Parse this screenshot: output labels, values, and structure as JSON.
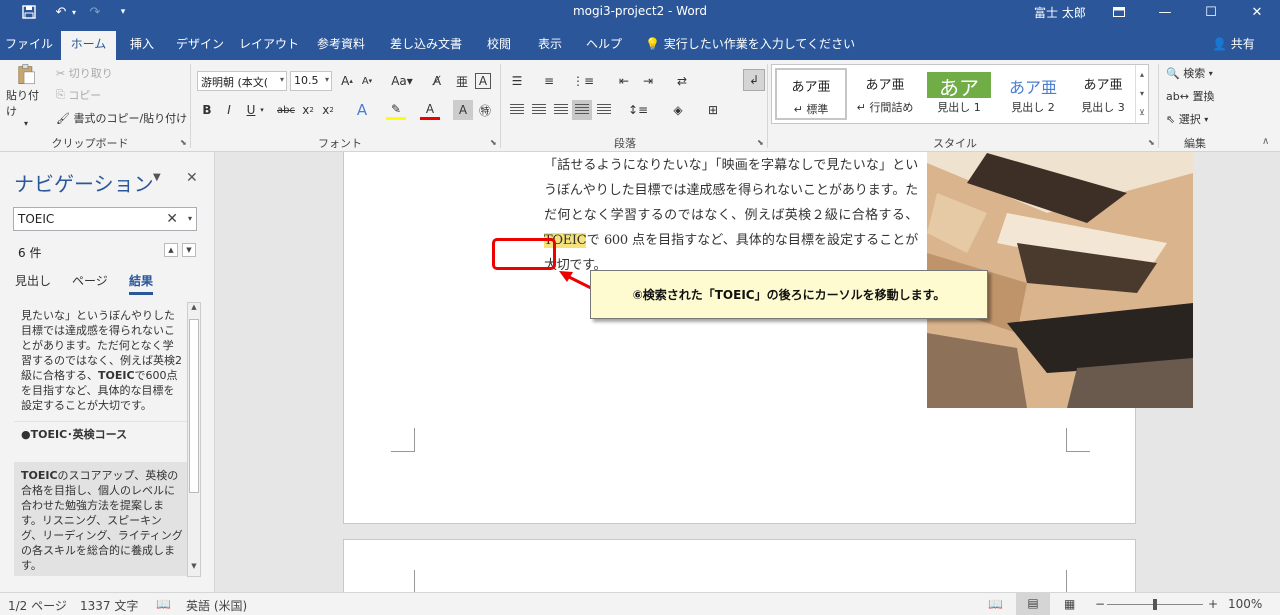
{
  "app": {
    "doc_title": "mogi3-project2  -  Word",
    "user": "富士 太郎"
  },
  "quick_access": [
    "save-icon",
    "undo-icon",
    "redo-icon",
    "customize-icon"
  ],
  "tabs": [
    {
      "label": "ファイル"
    },
    {
      "label": "ホーム",
      "active": true
    },
    {
      "label": "挿入"
    },
    {
      "label": "デザイン"
    },
    {
      "label": "レイアウト"
    },
    {
      "label": "参考資料"
    },
    {
      "label": "差し込み文書"
    },
    {
      "label": "校閲"
    },
    {
      "label": "表示"
    },
    {
      "label": "ヘルプ"
    }
  ],
  "tell_me": "実行したい作業を入力してください",
  "share": "共有",
  "clipboard": {
    "paste": "貼り付け",
    "cut": "切り取り",
    "copy": "コピー",
    "format_painter": "書式のコピー/貼り付け",
    "group": "クリップボード"
  },
  "font": {
    "name": "游明朝 (本文(",
    "size": "10.5",
    "group": "フォント"
  },
  "paragraph": {
    "group": "段落"
  },
  "styles": {
    "group": "スタイル",
    "items": [
      {
        "preview": "あア亜",
        "name": "↵ 標準"
      },
      {
        "preview": "あア亜",
        "name": "↵ 行間詰め"
      },
      {
        "preview": "あア",
        "name": "見出し 1"
      },
      {
        "preview": "あア亜",
        "name": "見出し 2"
      },
      {
        "preview": "あア亜",
        "name": "見出し 3"
      }
    ]
  },
  "editing": {
    "find": "検索",
    "replace": "置換",
    "select": "選択",
    "group": "編集"
  },
  "nav": {
    "title": "ナビゲーション",
    "search_value": "TOEIC",
    "count": "6 件",
    "tabs": [
      "見出し",
      "ページ",
      "結果"
    ],
    "results": [
      {
        "pre": "見たいな」というぼんやりした目標では達成感を得られないことがあります。ただ何となく学習するのではなく、例えば英検2級に合格する、",
        "kw": "TOEIC",
        "post": "で600点を目指すなど、具体的な目標を設定することが大切です。"
      },
      {
        "pre": "●",
        "kw": "TOEIC",
        "post": "･英検コース"
      },
      {
        "pre": "",
        "kw": "TOEIC",
        "post": "のスコアアップ、英検の合格を目指し、個人のレベルに合わせた勉強方法を提案します。リスニング、スピーキング、リーディング、ライティングの各スキルを総合的に養成します。"
      }
    ]
  },
  "document": {
    "text_before": "「話せるようになりたいな」「映画を字幕なしで見たいな」というぼんやりした目標では達成感を得られないことがあります。ただ何となく学習するのではなく、例えば英検２級に合格する、",
    "highlight": "TOEIC",
    "text_after": "で 600 点を目指すなど、具体的な目標を設定することが大切です。"
  },
  "callout": "⑥検索された「TOEIC」の後ろにカーソルを移動します。",
  "status": {
    "page": "1/2 ページ",
    "words": "1337 文字",
    "language": "英語 (米国)",
    "zoom": "100%"
  },
  "colors": {
    "accent": "#2b579a",
    "highlight": "#f5e27a",
    "callout_bg": "#fffbd0",
    "marker": "#e00000"
  }
}
